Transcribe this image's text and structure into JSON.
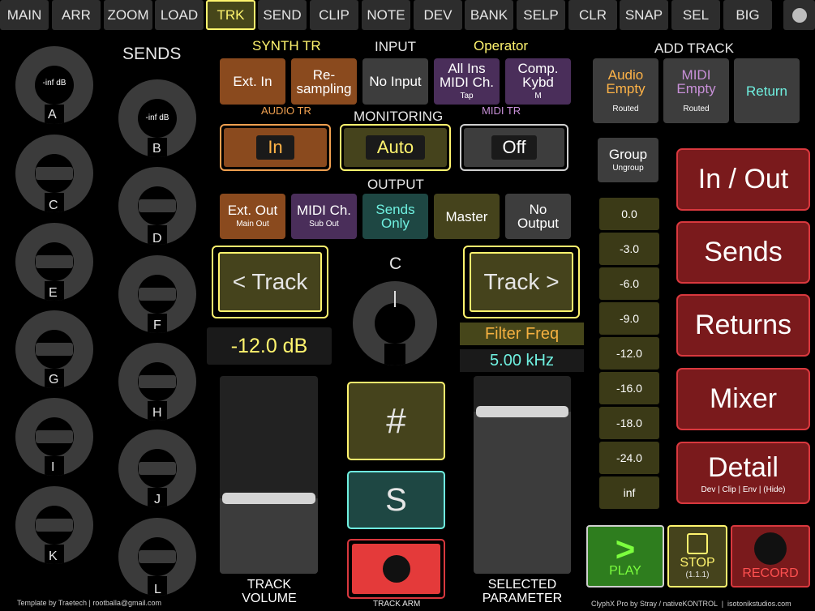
{
  "tabs": [
    {
      "label": "MAIN"
    },
    {
      "label": "ARR"
    },
    {
      "label": "ZOOM"
    },
    {
      "label": "LOAD"
    },
    {
      "label": "TRK",
      "selected": true
    },
    {
      "label": "SEND"
    },
    {
      "label": "CLIP"
    },
    {
      "label": "NOTE"
    },
    {
      "label": "DEV"
    },
    {
      "label": "BANK"
    },
    {
      "label": "SELP"
    },
    {
      "label": "CLR"
    },
    {
      "label": "SNAP"
    },
    {
      "label": "SEL"
    },
    {
      "label": "BIG"
    }
  ],
  "knobs": {
    "a": {
      "label": "A",
      "value": "-inf dB"
    },
    "b": {
      "label": "B",
      "value": "-inf dB"
    },
    "c": {
      "label": "C"
    },
    "d": {
      "label": "D"
    },
    "e": {
      "label": "E"
    },
    "f": {
      "label": "F"
    },
    "g": {
      "label": "G"
    },
    "h": {
      "label": "H"
    },
    "i": {
      "label": "I"
    },
    "j": {
      "label": "J"
    },
    "k": {
      "label": "K"
    },
    "l": {
      "label": "L"
    }
  },
  "sends_title": "SENDS",
  "headers": {
    "synth_tr": "SYNTH TR",
    "input": "INPUT",
    "operator": "Operator",
    "add_track": "ADD TRACK",
    "audio_tr": "AUDIO TR",
    "monitoring": "MONITORING",
    "midi_tr": "MIDI TR",
    "output": "OUTPUT"
  },
  "input_buttons": {
    "ext_in": "Ext. In",
    "resampling": "Re-\nsampling",
    "no_input": "No Input",
    "all_ins": "All Ins\nMIDI Ch.",
    "all_ins_sub": "Tap",
    "comp": "Comp.\nKybd",
    "comp_sub": "M"
  },
  "add_track": {
    "audio": "Audio\nEmpty",
    "audio_sub": "Routed",
    "midi": "MIDI\nEmpty",
    "midi_sub": "Routed",
    "return": "Return"
  },
  "monitoring": {
    "in": "In",
    "auto": "Auto",
    "off": "Off"
  },
  "group": {
    "label": "Group",
    "sub": "Ungroup"
  },
  "output_buttons": {
    "ext_out": "Ext. Out",
    "ext_out_sub": "Main Out",
    "midi_ch": "MIDI Ch.",
    "midi_ch_sub": "Sub Out",
    "sends_only": "Sends\nOnly",
    "master": "Master",
    "no_output": "No\nOutput"
  },
  "nav": {
    "prev": "< Track",
    "next": "Track >"
  },
  "center_knob_label": "C",
  "volume": {
    "readout": "-12.0 dB",
    "label": "TRACK\nVOLUME",
    "level": 0.38
  },
  "param": {
    "name": "Filter Freq",
    "value": "5.00 kHz",
    "label": "SELECTED\nPARAMETER",
    "level": 0.82
  },
  "levels": [
    "0.0",
    "-3.0",
    "-6.0",
    "-9.0",
    "-12.0",
    "-16.0",
    "-18.0",
    "-24.0",
    "inf"
  ],
  "right_panel": {
    "in_out": "In / Out",
    "sends": "Sends",
    "returns": "Returns",
    "mixer": "Mixer",
    "detail": "Detail",
    "detail_sub": "Dev | Clip | Env | (Hide)"
  },
  "hash": "#",
  "solo": "S",
  "track_arm": "TRACK ARM",
  "transport": {
    "play": "PLAY",
    "play_icon": ">",
    "stop": "STOP",
    "stop_sub": "(1.1.1)",
    "record": "RECORD"
  },
  "footer": {
    "left": "Template by Traetech | rootballa@gmail.com",
    "right": "ClyphX Pro by Stray / nativeKONTROL  |  isotonikstudios.com"
  },
  "colors": {
    "accent_yellow": "#fff46e",
    "brown": "#8a4a1e",
    "purple": "#4a2e5a",
    "teal_text": "#6ff0e0",
    "red": "#d9383e",
    "green": "#2e7d1e"
  }
}
